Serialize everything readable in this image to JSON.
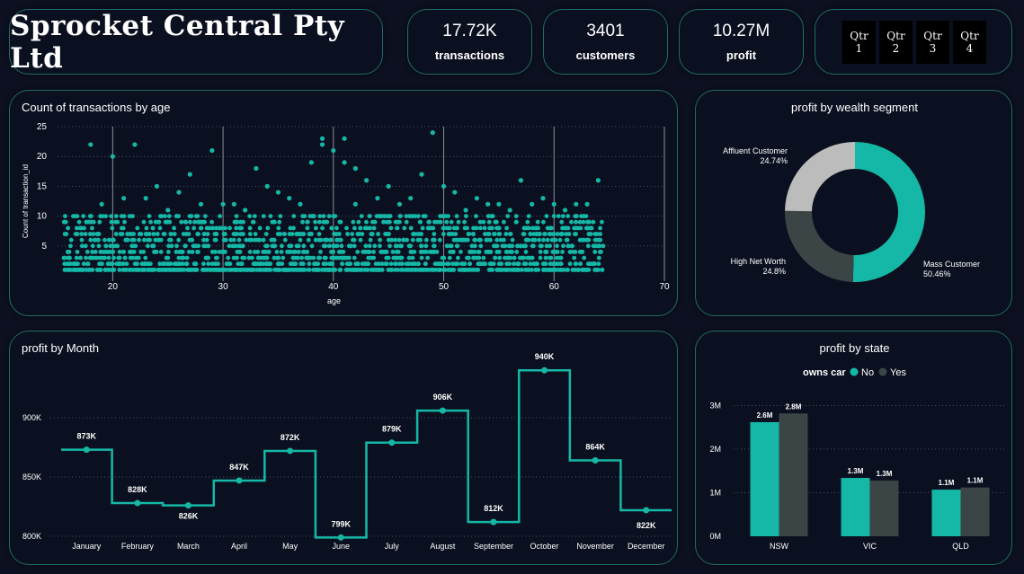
{
  "header": {
    "title": "Sprocket Central Pty Ltd"
  },
  "kpis": [
    {
      "value": "17.72K",
      "label": "transactions"
    },
    {
      "value": "3401",
      "label": "customers"
    },
    {
      "value": "10.27M",
      "label": "profit"
    }
  ],
  "quarter_slicer": [
    {
      "line1": "Qtr",
      "line2": "1"
    },
    {
      "line1": "Qtr",
      "line2": "2"
    },
    {
      "line1": "Qtr",
      "line2": "3"
    },
    {
      "line1": "Qtr",
      "line2": "4"
    }
  ],
  "colors": {
    "teal": "#15b8a6",
    "dark_grey": "#3b4546",
    "light_grey": "#bcbcbc",
    "border": "#1f6b6a"
  },
  "chart_data": [
    {
      "id": "scatter",
      "type": "scatter",
      "title": "Count of transactions by age",
      "xlabel": "age",
      "ylabel": "Count of transaction_id",
      "xlim": [
        15,
        70
      ],
      "ylim": [
        0,
        25
      ],
      "x_ticks": [
        20,
        30,
        40,
        50,
        60,
        70
      ],
      "y_ticks": [
        5,
        10,
        15,
        20,
        25
      ],
      "points": [
        [
          18,
          22
        ],
        [
          20,
          20
        ],
        [
          22,
          22
        ],
        [
          27,
          17
        ],
        [
          29,
          21
        ],
        [
          33,
          18
        ],
        [
          34,
          15
        ],
        [
          35,
          14
        ],
        [
          38,
          19
        ],
        [
          39,
          22
        ],
        [
          39,
          23
        ],
        [
          40,
          21
        ],
        [
          41,
          23
        ],
        [
          41,
          19
        ],
        [
          42,
          18
        ],
        [
          43,
          16
        ],
        [
          45,
          15
        ],
        [
          48,
          17
        ],
        [
          49,
          24
        ],
        [
          50,
          15
        ],
        [
          51,
          14
        ],
        [
          53,
          13
        ],
        [
          57,
          16
        ],
        [
          62,
          12
        ],
        [
          63,
          12
        ],
        [
          64,
          16
        ],
        [
          24,
          15
        ],
        [
          26,
          14
        ],
        [
          31,
          12
        ],
        [
          36,
          13
        ],
        [
          44,
          13
        ],
        [
          47,
          13
        ],
        [
          55,
          12
        ],
        [
          59,
          13
        ],
        [
          21,
          13
        ],
        [
          25,
          11
        ],
        [
          28,
          12
        ],
        [
          32,
          11
        ],
        [
          37,
          12
        ],
        [
          46,
          12
        ],
        [
          52,
          11
        ],
        [
          56,
          11
        ],
        [
          58,
          12
        ],
        [
          61,
          11
        ],
        [
          19,
          12
        ],
        [
          23,
          13
        ],
        [
          30,
          12
        ],
        [
          42,
          12
        ],
        [
          54,
          12
        ],
        [
          60,
          12
        ]
      ],
      "bulk": {
        "x_range": [
          16,
          64
        ],
        "y_range": [
          1,
          10
        ]
      }
    },
    {
      "id": "donut",
      "type": "pie",
      "title": "profit by wealth segment",
      "segments": [
        {
          "name": "Mass Customer",
          "percent": 50.46,
          "label": "50.46%",
          "color": "#15b8a6"
        },
        {
          "name": "High Net Worth",
          "percent": 24.8,
          "label": "24.8%",
          "color": "#3b4546"
        },
        {
          "name": "Affluent Customer",
          "percent": 24.74,
          "label": "24.74%",
          "color": "#bcbcbc"
        }
      ]
    },
    {
      "id": "month",
      "type": "line",
      "title": "profit by Month",
      "ylim": [
        800000,
        950000
      ],
      "y_ticks": [
        {
          "value": 800000,
          "label": "800K"
        },
        {
          "value": 850000,
          "label": "850K"
        },
        {
          "value": 900000,
          "label": "900K"
        }
      ],
      "categories": [
        "January",
        "February",
        "March",
        "April",
        "May",
        "June",
        "July",
        "August",
        "September",
        "October",
        "November",
        "December"
      ],
      "values": [
        873000,
        828000,
        826000,
        847000,
        872000,
        799000,
        879000,
        906000,
        812000,
        940000,
        864000,
        822000
      ],
      "labels": [
        "873K",
        "828K",
        "826K",
        "847K",
        "872K",
        "799K",
        "879K",
        "906K",
        "812K",
        "940K",
        "864K",
        "822K"
      ]
    },
    {
      "id": "state",
      "type": "bar",
      "title": "profit by state",
      "legend_title": "owns car",
      "categories": [
        "NSW",
        "VIC",
        "QLD"
      ],
      "ylim": [
        0,
        3300000
      ],
      "y_ticks": [
        {
          "value": 0,
          "label": "0M"
        },
        {
          "value": 1000000,
          "label": "1M"
        },
        {
          "value": 2000000,
          "label": "2M"
        },
        {
          "value": 3000000,
          "label": "3M"
        }
      ],
      "series": [
        {
          "name": "No",
          "color": "#15b8a6",
          "values": [
            2620000,
            1340000,
            1070000
          ],
          "labels": [
            "2.6M",
            "1.3M",
            "1.1M"
          ]
        },
        {
          "name": "Yes",
          "color": "#3b4546",
          "values": [
            2820000,
            1280000,
            1120000
          ],
          "labels": [
            "2.8M",
            "1.3M",
            "1.1M"
          ]
        }
      ]
    }
  ]
}
